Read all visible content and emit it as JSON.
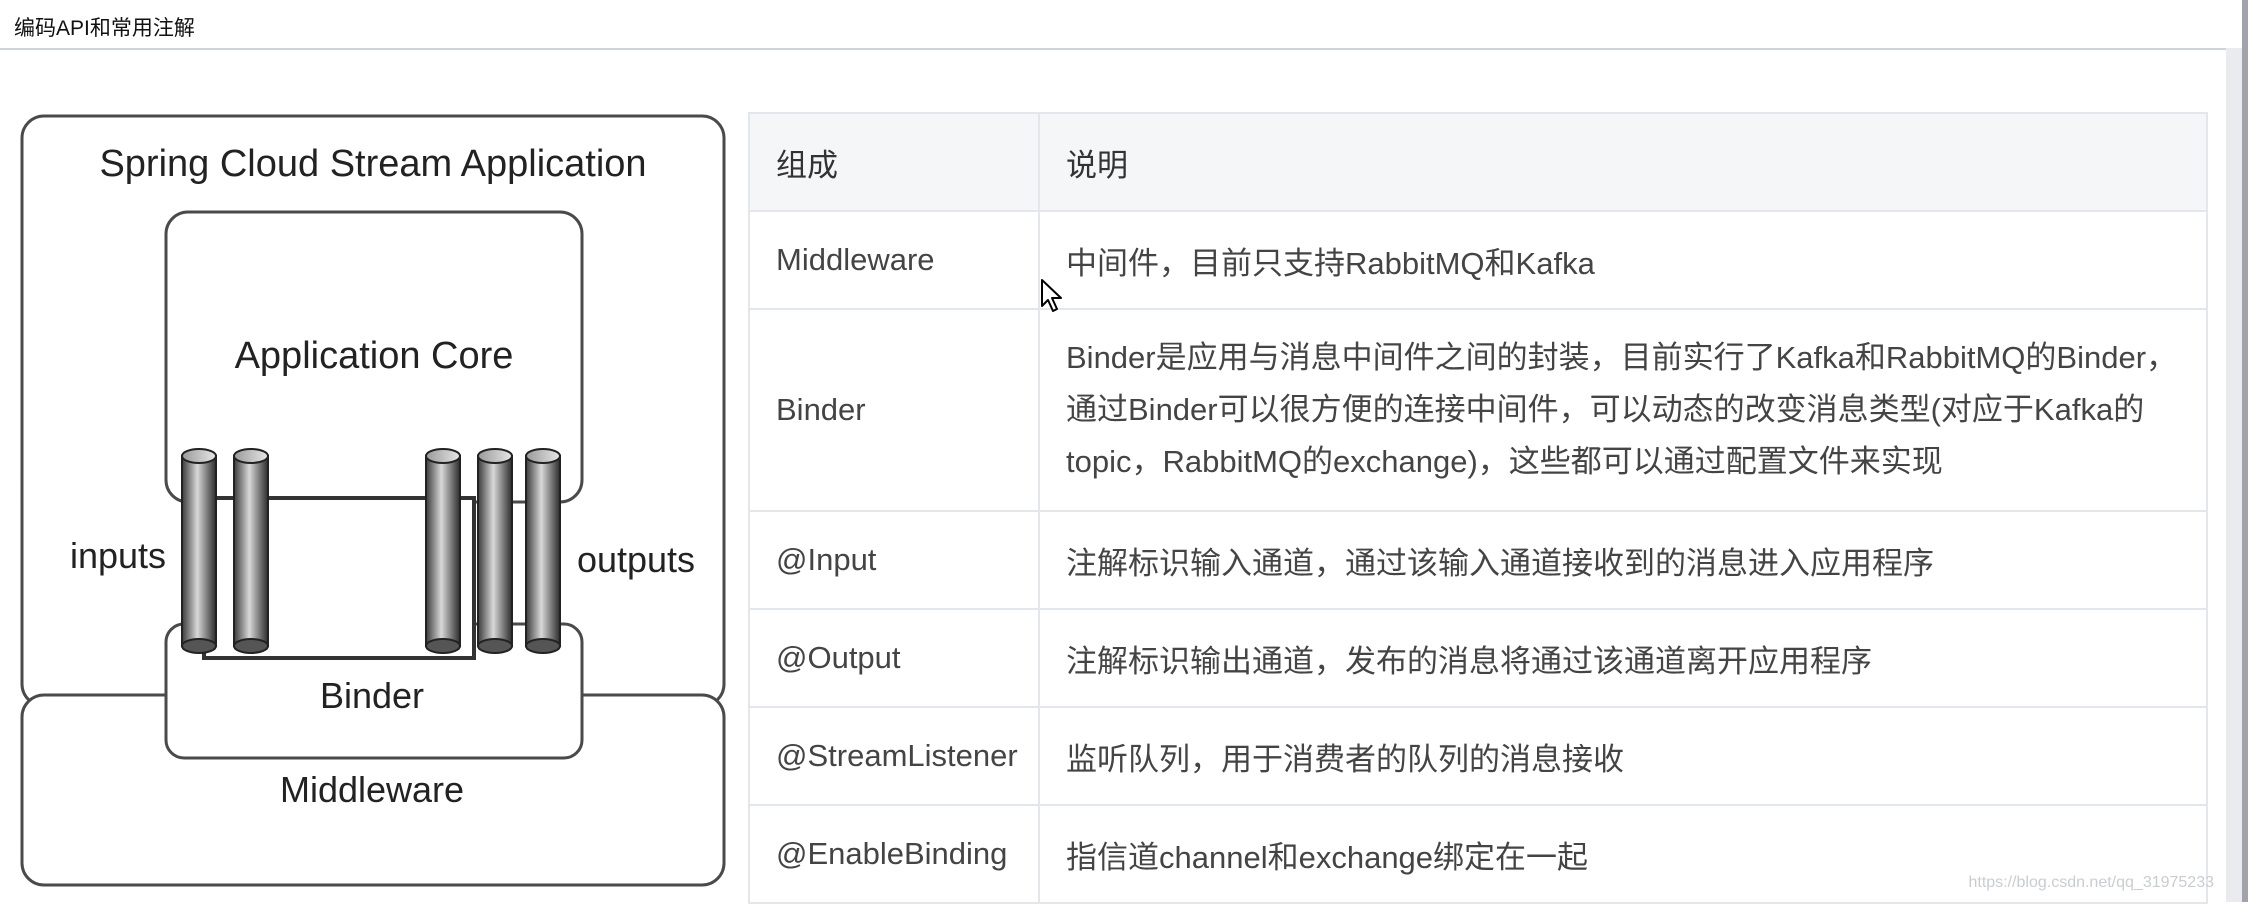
{
  "window": {
    "title": "编码API和常用注解"
  },
  "diagram": {
    "outer_title": "Spring Cloud Stream Application",
    "core_label": "Application Core",
    "inputs_label": "inputs",
    "outputs_label": "outputs",
    "binder_label": "Binder",
    "middleware_label": "Middleware"
  },
  "table": {
    "headers": [
      "组成",
      "说明"
    ],
    "rows": [
      {
        "name": "Middleware",
        "desc": "中间件，目前只支持RabbitMQ和Kafka"
      },
      {
        "name": "Binder",
        "desc": "Binder是应用与消息中间件之间的封装，目前实行了Kafka和RabbitMQ的Binder，通过Binder可以很方便的连接中间件，可以动态的改变消息类型(对应于Kafka的topic，RabbitMQ的exchange)，这些都可以通过配置文件来实现"
      },
      {
        "name": "@Input",
        "desc": "注解标识输入通道，通过该输入通道接收到的消息进入应用程序"
      },
      {
        "name": "@Output",
        "desc": "注解标识输出通道，发布的消息将通过该通道离开应用程序"
      },
      {
        "name": "@StreamListener",
        "desc": "监听队列，用于消费者的队列的消息接收"
      },
      {
        "name": "@EnableBinding",
        "desc": "指信道channel和exchange绑定在一起"
      }
    ]
  },
  "watermark": "https://blog.csdn.net/qq_31975233"
}
